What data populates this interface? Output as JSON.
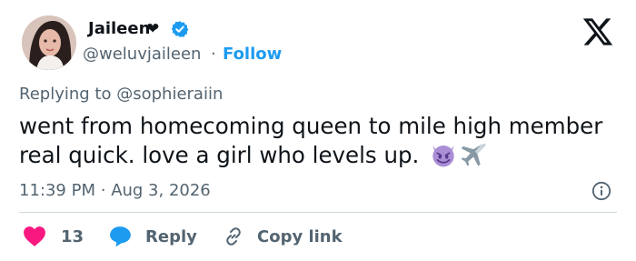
{
  "author": {
    "display_name": "Jaileen",
    "heart": "❤",
    "handle": "@weluvjaileen",
    "separator": "·",
    "follow_label": "Follow"
  },
  "reply_context": {
    "prefix": "Replying to",
    "mention": "@sophieraiin"
  },
  "tweet": {
    "text": "went from homecoming queen to mile high member real quick. love a girl who levels up.",
    "emojis": [
      "smiling-devil-emoji",
      "airplane-emoji"
    ]
  },
  "meta": {
    "time": "11:39 PM",
    "separator": "·",
    "date": "Aug 3, 2026"
  },
  "actions": {
    "like_count": "13",
    "reply_label": "Reply",
    "copy_link_label": "Copy link"
  },
  "colors": {
    "like": "#f91880",
    "reply": "#1d9bf0",
    "link": "#1d9bf0",
    "secondary_text": "#536471",
    "verified": "#1d9bf0",
    "devil": "#aa8ed6"
  }
}
